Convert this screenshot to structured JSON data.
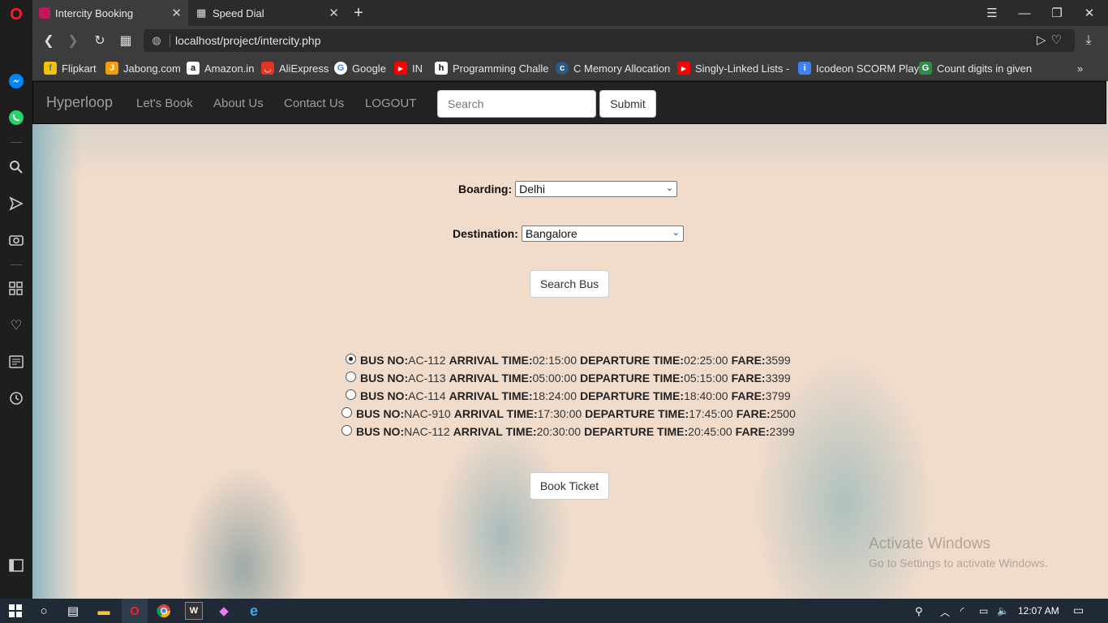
{
  "browser": {
    "tabs": [
      {
        "label": "Intercity Booking",
        "active": true
      },
      {
        "label": "Speed Dial",
        "active": false
      }
    ],
    "url": "localhost/project/intercity.php",
    "bookmarks": [
      {
        "label": "Flipkart",
        "icon": "flipkart-icon",
        "color": "#f5c400"
      },
      {
        "label": "Jabong.com",
        "icon": "jabong-icon",
        "color": "#f59e0b"
      },
      {
        "label": "Amazon.in",
        "icon": "amazon-icon",
        "color": "#ffffff"
      },
      {
        "label": "AliExpress",
        "icon": "aliexpress-icon",
        "color": "#e43225"
      },
      {
        "label": "Google",
        "icon": "google-icon",
        "color": "#ffffff"
      },
      {
        "label": "IN",
        "icon": "youtube-icon",
        "color": "#ff0000"
      },
      {
        "label": "Programming Challe",
        "icon": "hackerrank-icon",
        "color": "#ffffff"
      },
      {
        "label": "C Memory Allocation",
        "icon": "c-icon",
        "color": "#2b5b84"
      },
      {
        "label": "Singly-Linked Lists - ",
        "icon": "youtube-icon",
        "color": "#ff0000"
      },
      {
        "label": "Icodeon SCORM Play",
        "icon": "icodeon-icon",
        "color": "#3b82f6"
      },
      {
        "label": "Count digits in given",
        "icon": "geeksforgeeks-icon",
        "color": "#2f8d46"
      }
    ]
  },
  "site": {
    "brand": "Hyperloop",
    "nav": [
      "Let's Book",
      "About Us",
      "Contact Us",
      "LOGOUT"
    ],
    "search_placeholder": "Search",
    "submit_label": "Submit"
  },
  "form": {
    "boarding_label": "Boarding:",
    "boarding_value": "Delhi",
    "destination_label": "Destination:",
    "destination_value": "Bangalore",
    "search_button": "Search Bus",
    "book_button": "Book Ticket"
  },
  "buses": [
    {
      "bus_no": "AC-112",
      "arrival": "02:15:00",
      "departure": "02:25:00",
      "fare": "3599",
      "selected": true
    },
    {
      "bus_no": "AC-113",
      "arrival": "05:00:00",
      "departure": "05:15:00",
      "fare": "3399",
      "selected": false
    },
    {
      "bus_no": "AC-114",
      "arrival": "18:24:00",
      "departure": "18:40:00",
      "fare": "3799",
      "selected": false
    },
    {
      "bus_no": "NAC-910",
      "arrival": "17:30:00",
      "departure": "17:45:00",
      "fare": "2500",
      "selected": false
    },
    {
      "bus_no": "NAC-112",
      "arrival": "20:30:00",
      "departure": "20:45:00",
      "fare": "2399",
      "selected": false
    }
  ],
  "labels": {
    "bus_no": "BUS NO:",
    "arrival": "ARRIVAL TIME:",
    "departure": "DEPARTURE TIME:",
    "fare": "FARE:"
  },
  "watermark": {
    "line1": "Activate Windows",
    "line2": "Go to Settings to activate Windows."
  },
  "taskbar": {
    "time": "12:07 AM"
  }
}
